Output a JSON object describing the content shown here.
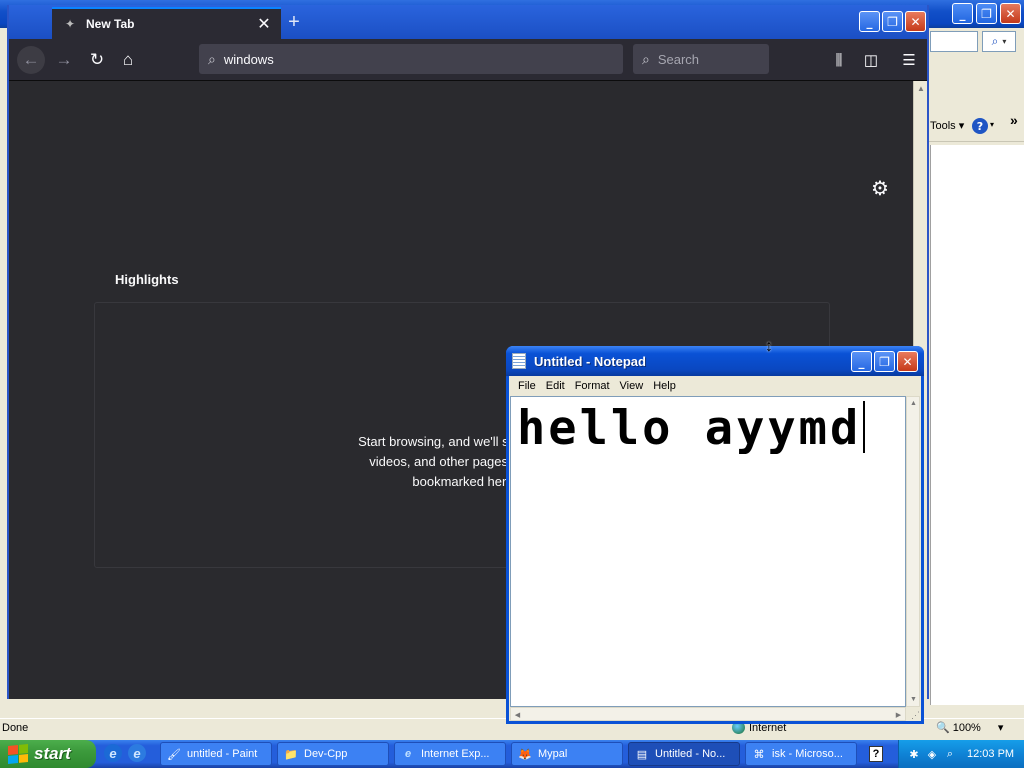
{
  "ie": {
    "window_buttons": {
      "minimize": "_",
      "maximize": "❐",
      "close": "✕"
    },
    "go_button": "⌕",
    "tools_menu": "Tools ▾",
    "help_icon": "?",
    "help_arrow": "▾",
    "chevron": "»",
    "status": "Done",
    "zone": "Internet",
    "zoom": "100%",
    "zoom_arrow": "▾"
  },
  "firefox": {
    "tab_title": "New Tab",
    "tab_close": "✕",
    "new_tab": "+",
    "window_buttons": {
      "minimize": "_",
      "maximize": "❐",
      "close": "✕"
    },
    "nav": {
      "back": "←",
      "forward": "→",
      "reload": "↻",
      "home": "⌂"
    },
    "url_value": "windows",
    "search_placeholder": "Search",
    "library_icon": "⫼",
    "sidebar_icon": "◫",
    "menu_icon": "☰",
    "gear_icon": "⚙",
    "highlights_heading": "Highlights",
    "empty_message": [
      "Start browsing, and we'll show some",
      "videos, and other pages you've r",
      "bookmarked here"
    ]
  },
  "notepad": {
    "title": "Untitled - Notepad",
    "window_buttons": {
      "minimize": "_",
      "maximize": "❐",
      "close": "✕"
    },
    "menu": [
      "File",
      "Edit",
      "Format",
      "View",
      "Help"
    ],
    "text": "hello ayymd"
  },
  "taskbar": {
    "start_label": "start",
    "tasks": [
      {
        "label": "untitled - Paint",
        "icon": "🖌"
      },
      {
        "label": "Dev-Cpp",
        "icon": "📁"
      },
      {
        "label": "Internet Exp...",
        "icon": "e"
      },
      {
        "label": "Mypal",
        "icon": "🦊"
      },
      {
        "label": "Untitled - No...",
        "icon": "▤"
      },
      {
        "label": "isk - Microso...",
        "icon": "⌘"
      }
    ],
    "help_icon": "?",
    "clock": "12:03 PM"
  }
}
